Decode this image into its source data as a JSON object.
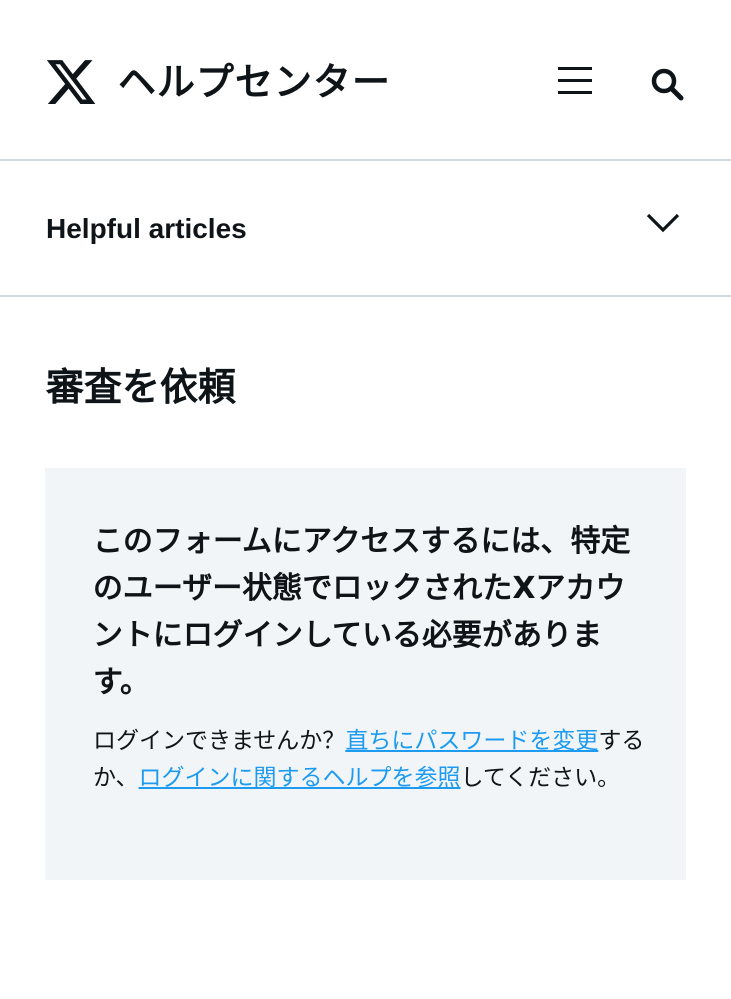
{
  "header": {
    "logo": "x-logo",
    "title": "ヘルプセンター",
    "menu_icon": "hamburger-menu-icon",
    "search_icon": "search-icon"
  },
  "accordion": {
    "label": "Helpful articles",
    "icon": "chevron-down-icon",
    "expanded": false
  },
  "page": {
    "title": "審査を依頼"
  },
  "notice": {
    "heading": "このフォームにアクセスするには、特定のユーザー状態でロックされたXアカウントにログインしている必要があります。",
    "body_prefix": "ログインできませんか？",
    "link_change_password": "直ちにパスワードを変更",
    "body_middle": "するか、",
    "link_login_help": "ログインに関するヘルプを参照",
    "body_suffix": "してください。"
  },
  "colors": {
    "text": "#0f1419",
    "link": "#1d9bf0",
    "divider": "#cfd9de",
    "notice_background": "#f2f5f8"
  }
}
